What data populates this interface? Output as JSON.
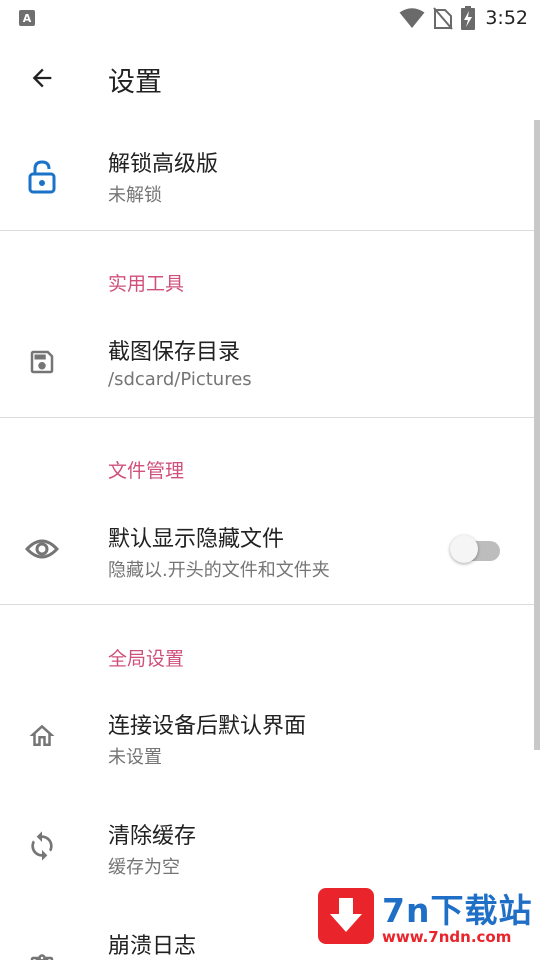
{
  "status_bar": {
    "left_icon_letter": "A",
    "time": "3:52",
    "icons": [
      "wifi-icon",
      "no-sim-icon",
      "battery-charging-icon"
    ]
  },
  "toolbar": {
    "back_icon": "arrow-back-icon",
    "title": "设置"
  },
  "unlock": {
    "icon": "lock-open-icon",
    "title": "解锁高级版",
    "summary": "未解锁"
  },
  "sections": {
    "tools": "实用工具",
    "file_manage": "文件管理",
    "global": "全局设置"
  },
  "screenshot_dir": {
    "icon": "save-icon",
    "title": "截图保存目录",
    "summary": "/sdcard/Pictures"
  },
  "show_hidden": {
    "icon": "eye-icon",
    "title": "默认显示隐藏文件",
    "summary": "隐藏以.开头的文件和文件夹",
    "enabled": false
  },
  "default_view": {
    "icon": "home-icon",
    "title": "连接设备后默认界面",
    "summary": "未设置"
  },
  "clear_cache": {
    "icon": "sync-icon",
    "title": "清除缓存",
    "summary": "缓存为空"
  },
  "crash_log": {
    "icon": "clipboard-icon",
    "title": "崩溃日志"
  },
  "watermark": {
    "title": "7n下载站",
    "url": "www.7ndn.com"
  },
  "colors": {
    "accent": "#d0507c",
    "lock_icon": "#1a73c9",
    "icon_gray": "#757575",
    "watermark_red": "#e9242b",
    "watermark_blue": "#1f6fc7"
  }
}
